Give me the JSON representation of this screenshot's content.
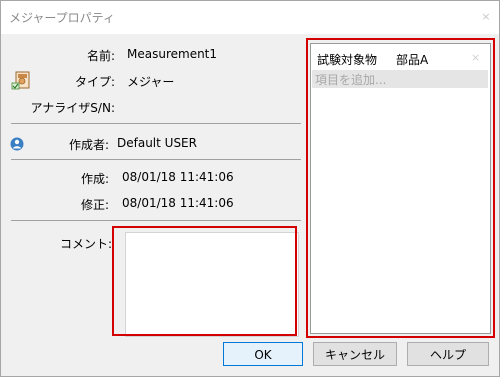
{
  "window": {
    "title": "メジャープロパティ",
    "close_glyph": "×"
  },
  "props": {
    "name_label": "名前:",
    "name_value": "Measurement1",
    "type_label": "タイプ:",
    "type_value": "メジャー",
    "analyzer_label": "アナライザS/N:",
    "analyzer_value": "",
    "creator_label": "作成者:",
    "creator_value": "Default USER",
    "created_label": "作成:",
    "created_value": "08/01/18 11:41:06",
    "modified_label": "修正:",
    "modified_value": "08/01/18 11:41:06",
    "comment_label": "コメント:",
    "comment_value": ""
  },
  "tags": {
    "rows": [
      {
        "key": "試験対象物",
        "value": "部品A"
      }
    ],
    "add_placeholder": "項目を追加...",
    "remove_glyph": "×"
  },
  "buttons": {
    "ok": "OK",
    "cancel": "キャンセル",
    "help": "ヘルプ"
  },
  "icons": {
    "measurement": "document-icon",
    "creator": "user-icon"
  },
  "colors": {
    "highlight": "#d40000",
    "ok_border": "#0078d7"
  }
}
